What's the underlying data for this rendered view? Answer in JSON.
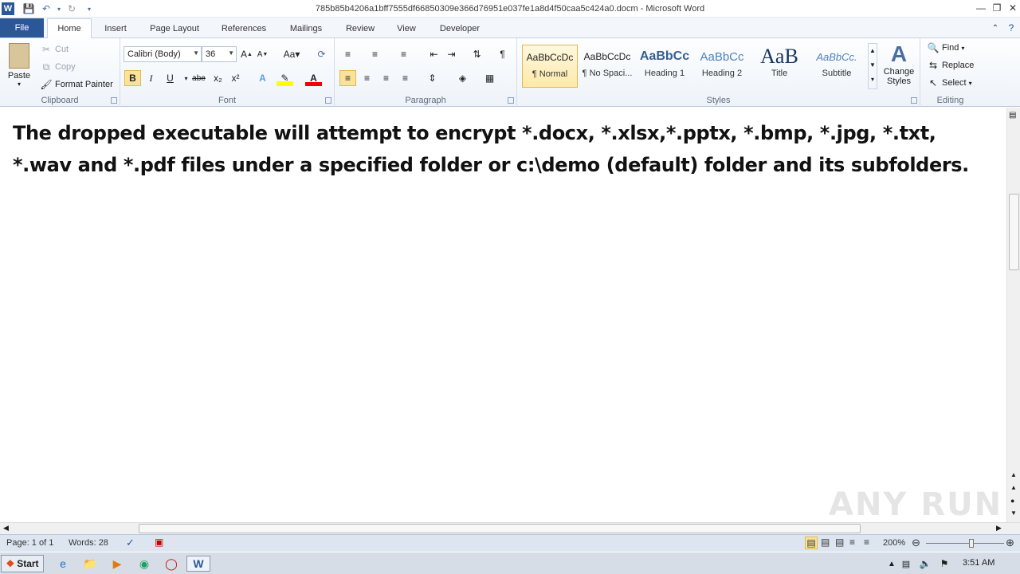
{
  "window": {
    "title": "785b85b4206a1bff7555df66850309e366d76951e037fe1a8d4f50caa5c424a0.docm - Microsoft Word"
  },
  "quick_access": {
    "word_icon": "word-icon",
    "save_icon": "save-icon",
    "undo_icon": "undo-icon",
    "redo_icon": "redo-icon"
  },
  "tabs": [
    "File",
    "Home",
    "Insert",
    "Page Layout",
    "References",
    "Mailings",
    "Review",
    "View",
    "Developer"
  ],
  "clipboard": {
    "paste": "Paste",
    "cut": "Cut",
    "copy": "Copy",
    "format_painter": "Format Painter",
    "label": "Clipboard"
  },
  "font": {
    "family": "Calibri (Body)",
    "size": "36",
    "label": "Font",
    "bold": "B",
    "italic": "I",
    "underline": "U",
    "strike": "abe",
    "subscript": "x₂",
    "superscript": "x²"
  },
  "paragraph": {
    "label": "Paragraph"
  },
  "styles": {
    "label": "Styles",
    "items": [
      {
        "sample": "AaBbCcDc",
        "name": "¶ Normal"
      },
      {
        "sample": "AaBbCcDc",
        "name": "¶ No Spaci..."
      },
      {
        "sample": "AaBbCc",
        "name": "Heading 1"
      },
      {
        "sample": "AaBbCc",
        "name": "Heading 2"
      },
      {
        "sample": "AaB",
        "name": "Title"
      },
      {
        "sample": "AaBbCc.",
        "name": "Subtitle"
      }
    ],
    "change_styles": "Change Styles"
  },
  "editing": {
    "label": "Editing",
    "find": "Find",
    "replace": "Replace",
    "select": "Select"
  },
  "document": {
    "text": "The dropped executable will attempt to encrypt *.docx, *.xlsx,*.pptx, *.bmp, *.jpg, *.txt, *.wav and *.pdf files under a specified folder or c:\\demo (default) folder and its subfolders."
  },
  "status": {
    "page": "Page: 1 of 1",
    "words": "Words: 28",
    "zoom": "200%"
  },
  "taskbar": {
    "start": "Start",
    "time": "3:51 AM"
  },
  "watermark": "ANY RUN",
  "colors": {
    "file_tab": "#2b5797",
    "highlight": "#fbe29a"
  }
}
